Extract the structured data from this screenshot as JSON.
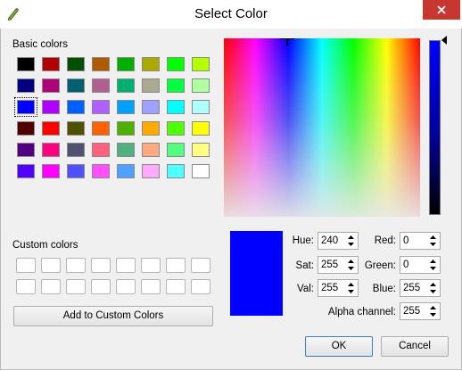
{
  "window": {
    "title": "Select Color"
  },
  "basic": {
    "label": "Basic colors",
    "colors": [
      "#000000",
      "#b00000",
      "#005000",
      "#b05a00",
      "#00b000",
      "#aaaa00",
      "#00ff00",
      "#b4ff00",
      "#000080",
      "#b0007a",
      "#006070",
      "#b06090",
      "#00b070",
      "#aaaa90",
      "#00ff40",
      "#b0ffa0",
      "#0000ff",
      "#b000ff",
      "#0060ff",
      "#b060ff",
      "#00a0ff",
      "#a0a0ff",
      "#00ffff",
      "#b0ffff",
      "#500000",
      "#ff0000",
      "#505000",
      "#ff6000",
      "#50b000",
      "#ffaa00",
      "#50ff00",
      "#ffff00",
      "#500080",
      "#ff0080",
      "#505070",
      "#ff6080",
      "#50b080",
      "#ffaa80",
      "#50ff80",
      "#ffff80",
      "#5000ff",
      "#ff00ff",
      "#5050ff",
      "#ff50ff",
      "#50a0ff",
      "#ffaaff",
      "#50ffff",
      "#ffffff"
    ],
    "selected_index": 16
  },
  "custom": {
    "label": "Custom colors",
    "count": 16
  },
  "add_button": "Add to Custom Colors",
  "fields": {
    "hue": {
      "label": "Hue:",
      "value": "240"
    },
    "sat": {
      "label": "Sat:",
      "value": "255"
    },
    "val": {
      "label": "Val:",
      "value": "255"
    },
    "red": {
      "label": "Red:",
      "value": "0"
    },
    "green": {
      "label": "Green:",
      "value": "0"
    },
    "blue": {
      "label": "Blue:",
      "value": "255"
    },
    "alpha": {
      "label": "Alpha channel:",
      "value": "255"
    }
  },
  "buttons": {
    "ok": "OK",
    "cancel": "Cancel"
  },
  "current_color": "#0000ff",
  "luminance_level": 1.0
}
